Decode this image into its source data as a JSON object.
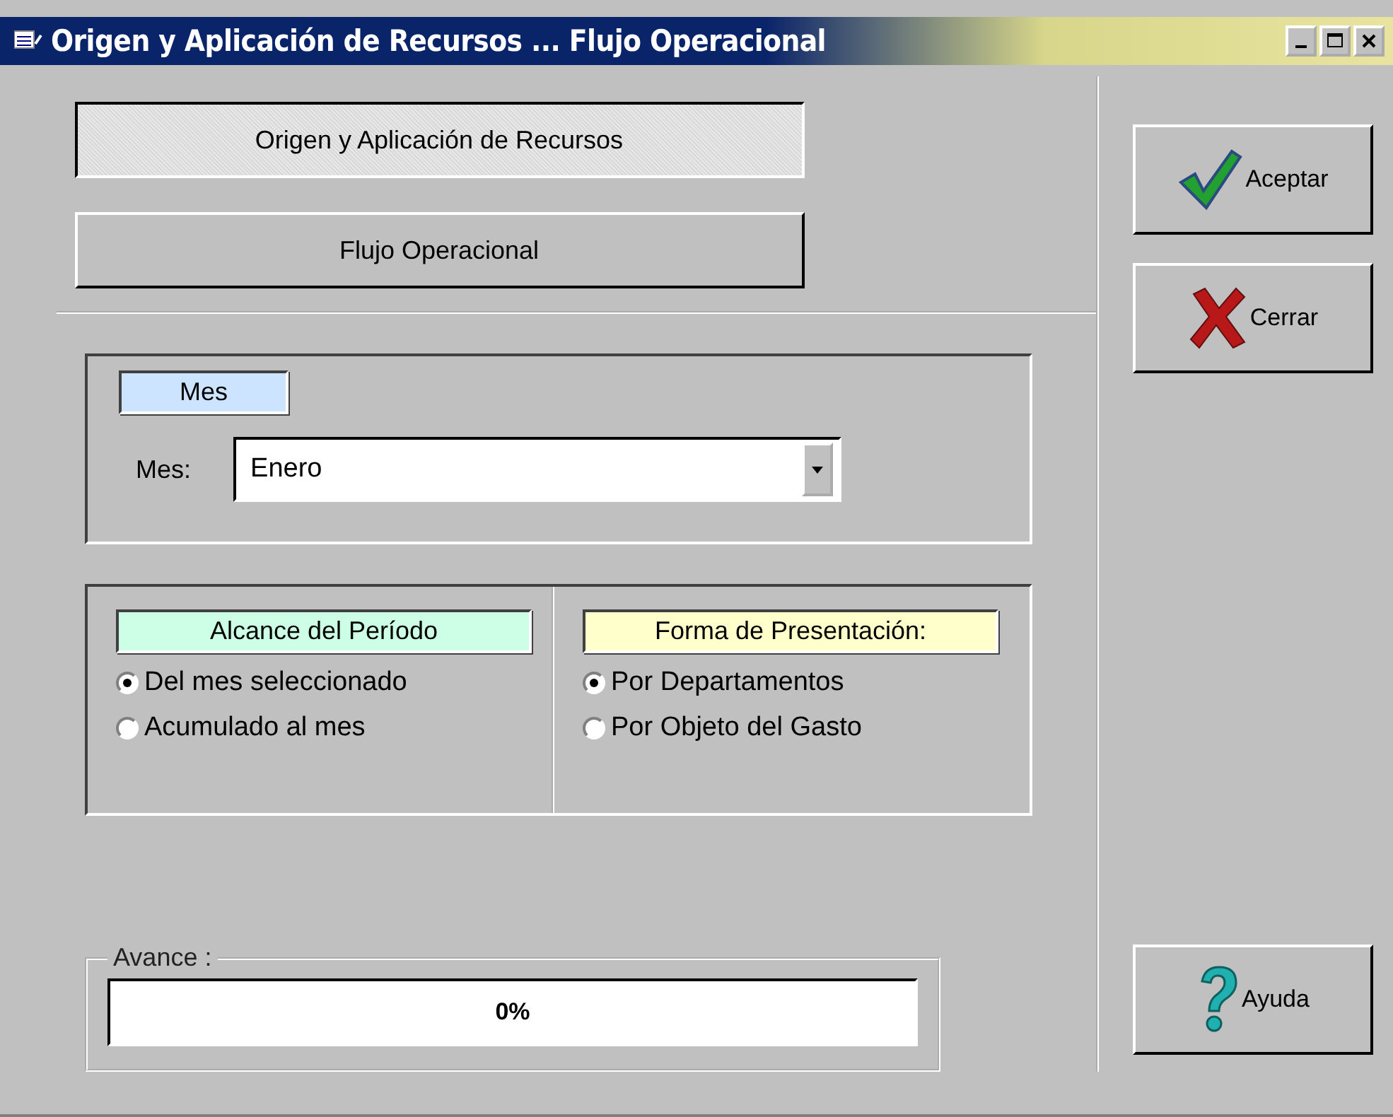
{
  "window": {
    "title": "Origen y Aplicación de Recursos ... Flujo Operacional"
  },
  "report_buttons": [
    {
      "label": "Origen y Aplicación de Recursos",
      "selected": true
    },
    {
      "label": "Flujo Operacional",
      "selected": false
    }
  ],
  "month_group": {
    "title": "Mes",
    "label": "Mes:",
    "value": "Enero"
  },
  "period_group": {
    "title": "Alcance del Período",
    "color": "#ccffe6",
    "options": [
      {
        "label": "Del mes seleccionado",
        "selected": true
      },
      {
        "label": "Acumulado al mes",
        "selected": false
      }
    ]
  },
  "presentation_group": {
    "title": "Forma de Presentación:",
    "color": "#ffffcc",
    "options": [
      {
        "label": "Por Departamentos",
        "selected": true
      },
      {
        "label": "Por Objeto del Gasto",
        "selected": false
      }
    ]
  },
  "progress": {
    "title": "Avance :",
    "level": 0,
    "reading": "0%"
  },
  "actions": [
    {
      "kind": "accept",
      "label": "Aceptar"
    },
    {
      "kind": "close",
      "label": "Cerrar"
    },
    {
      "kind": "help",
      "label": "Ayuda"
    }
  ]
}
